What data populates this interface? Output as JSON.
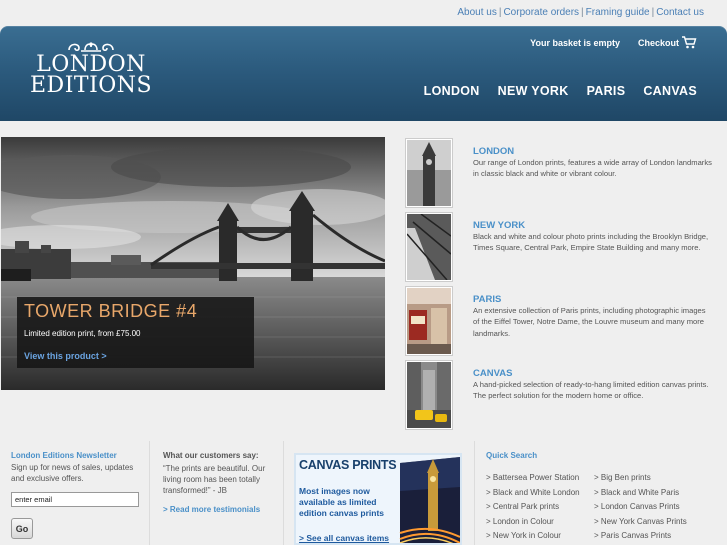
{
  "top_links": [
    "About us",
    "Corporate orders",
    "Framing guide",
    "Contact us"
  ],
  "logo": {
    "line1": "LONDON",
    "line2": "EDITIONS"
  },
  "header": {
    "basket": "Your basket is empty",
    "checkout": "Checkout"
  },
  "nav": [
    "LONDON",
    "NEW YORK",
    "PARIS",
    "CANVAS"
  ],
  "hero": {
    "title": "TOWER BRIDGE #4",
    "subtitle": "Limited edition print, from £75.00",
    "link": "View this product >"
  },
  "categories": [
    {
      "title": "LONDON",
      "desc": "Our range of London prints, features a wide array of London landmarks in classic black and white or vibrant colour."
    },
    {
      "title": "NEW YORK",
      "desc": "Black and white and colour photo prints including the Brooklyn Bridge, Times Square, Central Park, Empire State Building and many more."
    },
    {
      "title": "PARIS",
      "desc": "An extensive collection of Paris prints, including photographic images of the Eiffel Tower, Notre Dame, the Louvre museum and many more landmarks."
    },
    {
      "title": "CANVAS",
      "desc": "A hand-picked selection of ready-to-hang limited edition canvas prints. The perfect solution for the modern home or office."
    }
  ],
  "newsletter": {
    "title": "London Editions Newsletter",
    "text": "Sign up for news of sales, updates and exclusive offers.",
    "placeholder": "enter email",
    "button": "Go"
  },
  "testimonials": {
    "title": "What our customers say:",
    "quote": "“The prints are beautiful. Our living room has been totally transformed!” - JB",
    "link": "> Read more testimonials"
  },
  "canvas_banner": {
    "title": "CANVAS PRINTS",
    "body": "Most images now available as limited edition canvas prints",
    "link": "> See all canvas items"
  },
  "quick_search": {
    "title": "Quick Search",
    "links": [
      "> Battersea Power Station",
      "> Big Ben prints",
      "> Black and White London",
      "> Black and White Paris",
      "> Central Park prints",
      "> London Canvas Prints",
      "> London in Colour",
      "> New York Canvas Prints",
      "> New York in Colour",
      "> Paris Canvas Prints"
    ]
  }
}
